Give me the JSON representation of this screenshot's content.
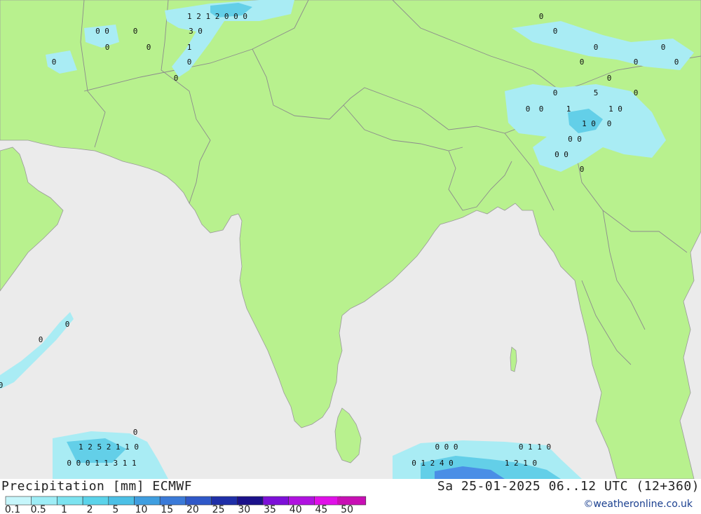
{
  "title": "Precipitation [mm] ECMWF",
  "datetime": "Sa 25-01-2025 06..12 UTC (12+360)",
  "credit": "©weatheronline.co.uk",
  "colors": {
    "sea": "#ebebeb",
    "land": "#b8f18e",
    "border": "#8c8c8c",
    "precip_light": "#a9ecf4",
    "precip_mid": "#63cfe8",
    "precip_heavy": "#4a8ee6"
  },
  "legend": {
    "labels": [
      "0.1",
      "0.5",
      "1",
      "2",
      "5",
      "10",
      "15",
      "20",
      "25",
      "30",
      "35",
      "40",
      "45",
      "50"
    ],
    "colors": [
      "#c6f6fb",
      "#9eedf6",
      "#7ce3f0",
      "#5bd3ea",
      "#4cc0e6",
      "#3f9ee0",
      "#3b7ad8",
      "#2f58c8",
      "#1f2fa8",
      "#1b118a",
      "#7d10d8",
      "#b012e0",
      "#e010e8",
      "#c80fb4"
    ]
  },
  "values": [
    {
      "text": "1 2 1 2 0 0 0"
    },
    {
      "text": "0 0"
    },
    {
      "text": "0"
    },
    {
      "text": "3 0"
    },
    {
      "text": "0"
    },
    {
      "text": "0"
    },
    {
      "text": "1"
    },
    {
      "text": "0"
    },
    {
      "text": "0"
    },
    {
      "text": "0"
    },
    {
      "text": "0"
    },
    {
      "text": "0"
    },
    {
      "text": "0"
    },
    {
      "text": "0"
    },
    {
      "text": "0"
    },
    {
      "text": "0"
    },
    {
      "text": "0"
    },
    {
      "text": "0"
    },
    {
      "text": "0"
    },
    {
      "text": "0"
    },
    {
      "text": "5"
    },
    {
      "text": "0"
    },
    {
      "text": "0"
    },
    {
      "text": "1"
    },
    {
      "text": "1 0"
    },
    {
      "text": "1 0"
    },
    {
      "text": "0"
    },
    {
      "text": "0 0"
    },
    {
      "text": "0 0"
    },
    {
      "text": "0"
    },
    {
      "text": "0"
    },
    {
      "text": "0"
    },
    {
      "text": "0"
    },
    {
      "text": "0"
    },
    {
      "text": "1 2 5 2 1 1 0"
    },
    {
      "text": "0 0 0 1 1 3 1 1"
    },
    {
      "text": "0 0 0"
    },
    {
      "text": "0 1 1 0"
    },
    {
      "text": "0 1 2 4 0"
    },
    {
      "text": "1 2 1 0"
    }
  ]
}
